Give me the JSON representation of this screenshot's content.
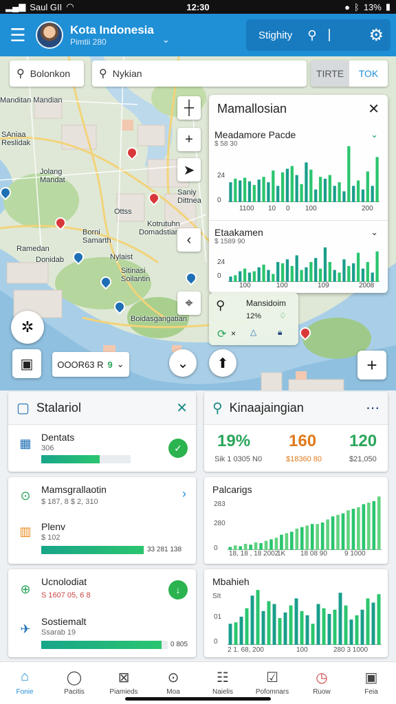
{
  "status": {
    "carrier": "Saul GII",
    "time": "12:30",
    "battery": "13%"
  },
  "appbar": {
    "title": "Kota Indonesia",
    "subtitle": "Pimtii 280",
    "action_label": "Stighity"
  },
  "map": {
    "search_place": "Bolonkon",
    "search_query": "Nykian",
    "toggle_off": "TIRTE",
    "toggle_on": "TOK",
    "filter_value": "OOOR63 R",
    "filter_flag": "9",
    "labels": [
      "Manditan Mandian",
      "SAniaa Reslidak",
      "Jolang",
      "Mandat",
      "Saniy Dittnea",
      "Ottss",
      "Borni Samarth",
      "Ramedan",
      "Sitinasi Soilantin",
      "Nylaist",
      "Kotrutuhn",
      "Domadstianian",
      "Donidab",
      "Boidasgangatian"
    ]
  },
  "overlay": {
    "title": "Mamallosian",
    "chart1": {
      "title": "Meadamore Pacde",
      "sub": "$ 58 30",
      "ticks_y": [
        "24",
        "0"
      ],
      "ticks_x": [
        "1100",
        "10",
        "0",
        "100",
        "200"
      ]
    },
    "chart2": {
      "title": "Etaakamen",
      "sub": "$ 1589 90",
      "ticks_y": [
        "24",
        "0"
      ],
      "ticks_x": [
        "100",
        "100",
        "109",
        "2008"
      ]
    }
  },
  "minicard": {
    "title": "Mansidoim",
    "value": "12%"
  },
  "card_left_top": {
    "title": "Stalariol",
    "row": {
      "title": "Dentats",
      "sub": "306",
      "progress": 0.65
    }
  },
  "card_left_mid": {
    "row1": {
      "title": "Mamsgrallaotin",
      "sub": "$ 187, 8 $ 2, 310"
    },
    "row2": {
      "title": "Plenv",
      "sub": "$ 102",
      "value_label": "33 281 138",
      "progress": 0.99
    }
  },
  "card_left_bot": {
    "row1": {
      "title": "Ucnolodiat",
      "sub": "S 1607 05, 6 8"
    },
    "row2": {
      "title": "Sostiemalt",
      "sub": "Ssarab 19",
      "value_label": "0 805",
      "progress": 0.95
    }
  },
  "card_right_top": {
    "title": "Kinaajaingian",
    "stats": [
      {
        "value": "19%",
        "sub": "Sik 1 0305 N0",
        "color": "#2aa55a"
      },
      {
        "value": "160",
        "sub": "$18360 80",
        "color": "#e07a1a"
      },
      {
        "value": "120",
        "sub": "$21,050",
        "color": "#2aa55a"
      }
    ]
  },
  "card_right_mid": {
    "title": "Palcarigs",
    "ticks_y": [
      "283",
      "280",
      "0"
    ],
    "ticks_x": [
      "18, 18 , 18 2002",
      "1K",
      "18 08 90",
      "9 1000"
    ]
  },
  "card_right_bot": {
    "title": "Mbahieh",
    "ticks_y": [
      "SIt",
      "01",
      "0"
    ],
    "ticks_x": [
      "2 1. 68, 200",
      "100",
      "280 3 1000"
    ]
  },
  "chart_data": [
    {
      "type": "bar",
      "title": "Meadamore Pacde",
      "values": [
        22,
        26,
        24,
        27,
        23,
        19,
        25,
        28,
        22,
        35,
        18,
        33,
        37,
        40,
        30,
        20,
        44,
        36,
        14,
        28,
        26,
        30,
        18,
        22,
        12,
        62,
        18,
        24,
        14,
        34,
        18,
        50
      ],
      "colors": [
        "#1a9e8b",
        "#2bc56f"
      ]
    },
    {
      "type": "bar",
      "title": "Etaakamen",
      "values": [
        8,
        10,
        16,
        20,
        14,
        16,
        22,
        26,
        18,
        12,
        30,
        28,
        34,
        24,
        40,
        18,
        22,
        30,
        36,
        20,
        52,
        30,
        18,
        14,
        34,
        24,
        28,
        44,
        20,
        30,
        14,
        46
      ],
      "colors": [
        "#1a9e8b",
        "#2bc56f"
      ]
    },
    {
      "type": "bar",
      "title": "Palcarigs",
      "values": [
        4,
        6,
        5,
        8,
        7,
        10,
        9,
        12,
        14,
        16,
        20,
        22,
        24,
        28,
        30,
        32,
        34,
        34,
        36,
        40,
        44,
        46,
        48,
        52,
        54,
        56,
        60,
        62,
        64,
        70
      ],
      "colors": [
        "#2bc56f",
        "#62d37f"
      ]
    },
    {
      "type": "bar",
      "title": "Mbahieh",
      "values": [
        30,
        32,
        40,
        52,
        70,
        78,
        48,
        62,
        58,
        38,
        46,
        56,
        66,
        48,
        42,
        30,
        58,
        52,
        44,
        50,
        74,
        56,
        36,
        42,
        50,
        66,
        60,
        72
      ],
      "colors": [
        "#1a9e8b",
        "#2bc56f"
      ]
    }
  ],
  "bottomnav": [
    {
      "label": "Fonie",
      "icon": "home-icon"
    },
    {
      "label": "Pacitis",
      "icon": "chat-icon"
    },
    {
      "label": "Piamieds",
      "icon": "box-icon"
    },
    {
      "label": "Moa",
      "icon": "compass-icon"
    },
    {
      "label": "Naielis",
      "icon": "list-icon"
    },
    {
      "label": "Pofomnars",
      "icon": "check-icon"
    },
    {
      "label": "Ruow",
      "icon": "clock-icon"
    },
    {
      "label": "Feia",
      "icon": "profile-icon"
    }
  ]
}
